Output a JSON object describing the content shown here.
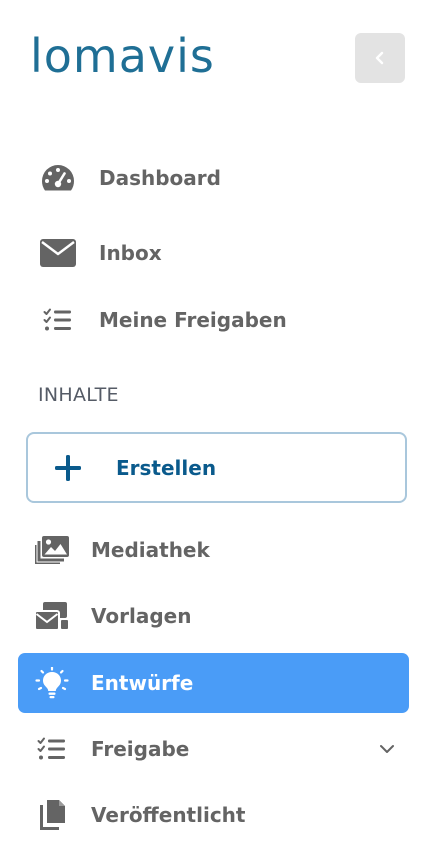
{
  "brand": {
    "logo_text": "lomavis",
    "logo_color": "#1f6f95",
    "primary_color": "#0a5a8c",
    "active_color": "#4a9cf7"
  },
  "header": {
    "collapse_icon": "chevron-left-icon"
  },
  "nav": {
    "items": [
      {
        "label": "Dashboard",
        "icon": "gauge-icon"
      },
      {
        "label": "Inbox",
        "icon": "envelope-icon"
      },
      {
        "label": "Meine Freigaben",
        "icon": "checklist-icon"
      }
    ]
  },
  "content_section": {
    "title": "INHALTE",
    "create_label": "Erstellen",
    "create_icon": "plus-icon",
    "items": [
      {
        "label": "Mediathek",
        "icon": "images-icon",
        "active": false
      },
      {
        "label": "Vorlagen",
        "icon": "templates-icon",
        "active": false
      },
      {
        "label": "Entwürfe",
        "icon": "lightbulb-icon",
        "active": true
      },
      {
        "label": "Freigabe",
        "icon": "checklist-icon",
        "active": false,
        "expandable": true
      },
      {
        "label": "Veröffentlicht",
        "icon": "copy-icon",
        "active": false
      }
    ]
  }
}
